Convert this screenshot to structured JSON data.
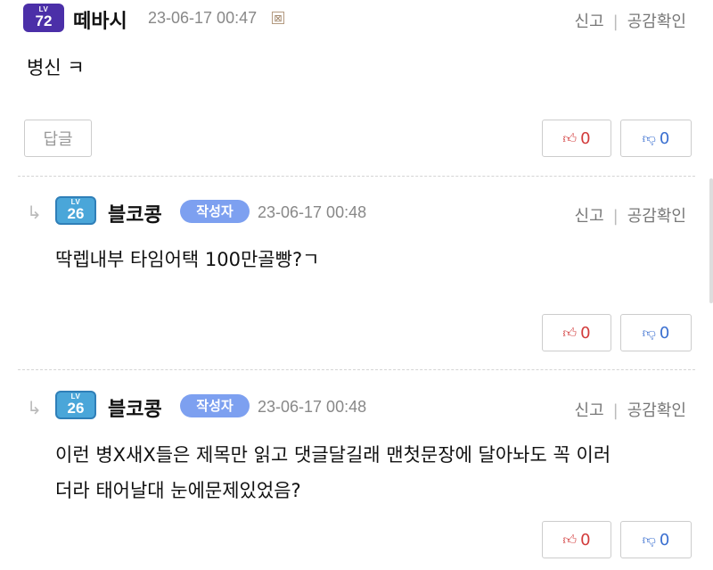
{
  "comments": [
    {
      "level_label": "LV",
      "level": "72",
      "nickname": "떼바시",
      "date": "23-06-17 00:47",
      "x_mark": "⊠",
      "report": "신고",
      "sympathy": "공감확인",
      "text": "병신 ㅋ",
      "reply_button": "답글",
      "likes": "0",
      "dislikes": "0"
    },
    {
      "reply_arrow": "↳",
      "level_label": "LV",
      "level": "26",
      "nickname": "블코콩",
      "author_tag": "작성자",
      "date": "23-06-17 00:48",
      "report": "신고",
      "sympathy": "공감확인",
      "text": "딱렙내부 타임어택 100만골빵?ㄱ",
      "likes": "0",
      "dislikes": "0"
    },
    {
      "reply_arrow": "↳",
      "level_label": "LV",
      "level": "26",
      "nickname": "블코콩",
      "author_tag": "작성자",
      "date": "23-06-17 00:48",
      "report": "신고",
      "sympathy": "공감확인",
      "text_line1": "이런 병X새X들은 제목만 읽고 댓글달길래 맨첫문장에 달아놔도 꼭 이러",
      "text_line2": "더라 태어날대 눈에문제있었음?",
      "likes": "0",
      "dislikes": "0"
    }
  ],
  "icons": {
    "like": "thumbs-up-icon",
    "dislike": "thumbs-down-icon",
    "like_color": "#d23b3b",
    "dislike_color": "#3a6fd0"
  }
}
